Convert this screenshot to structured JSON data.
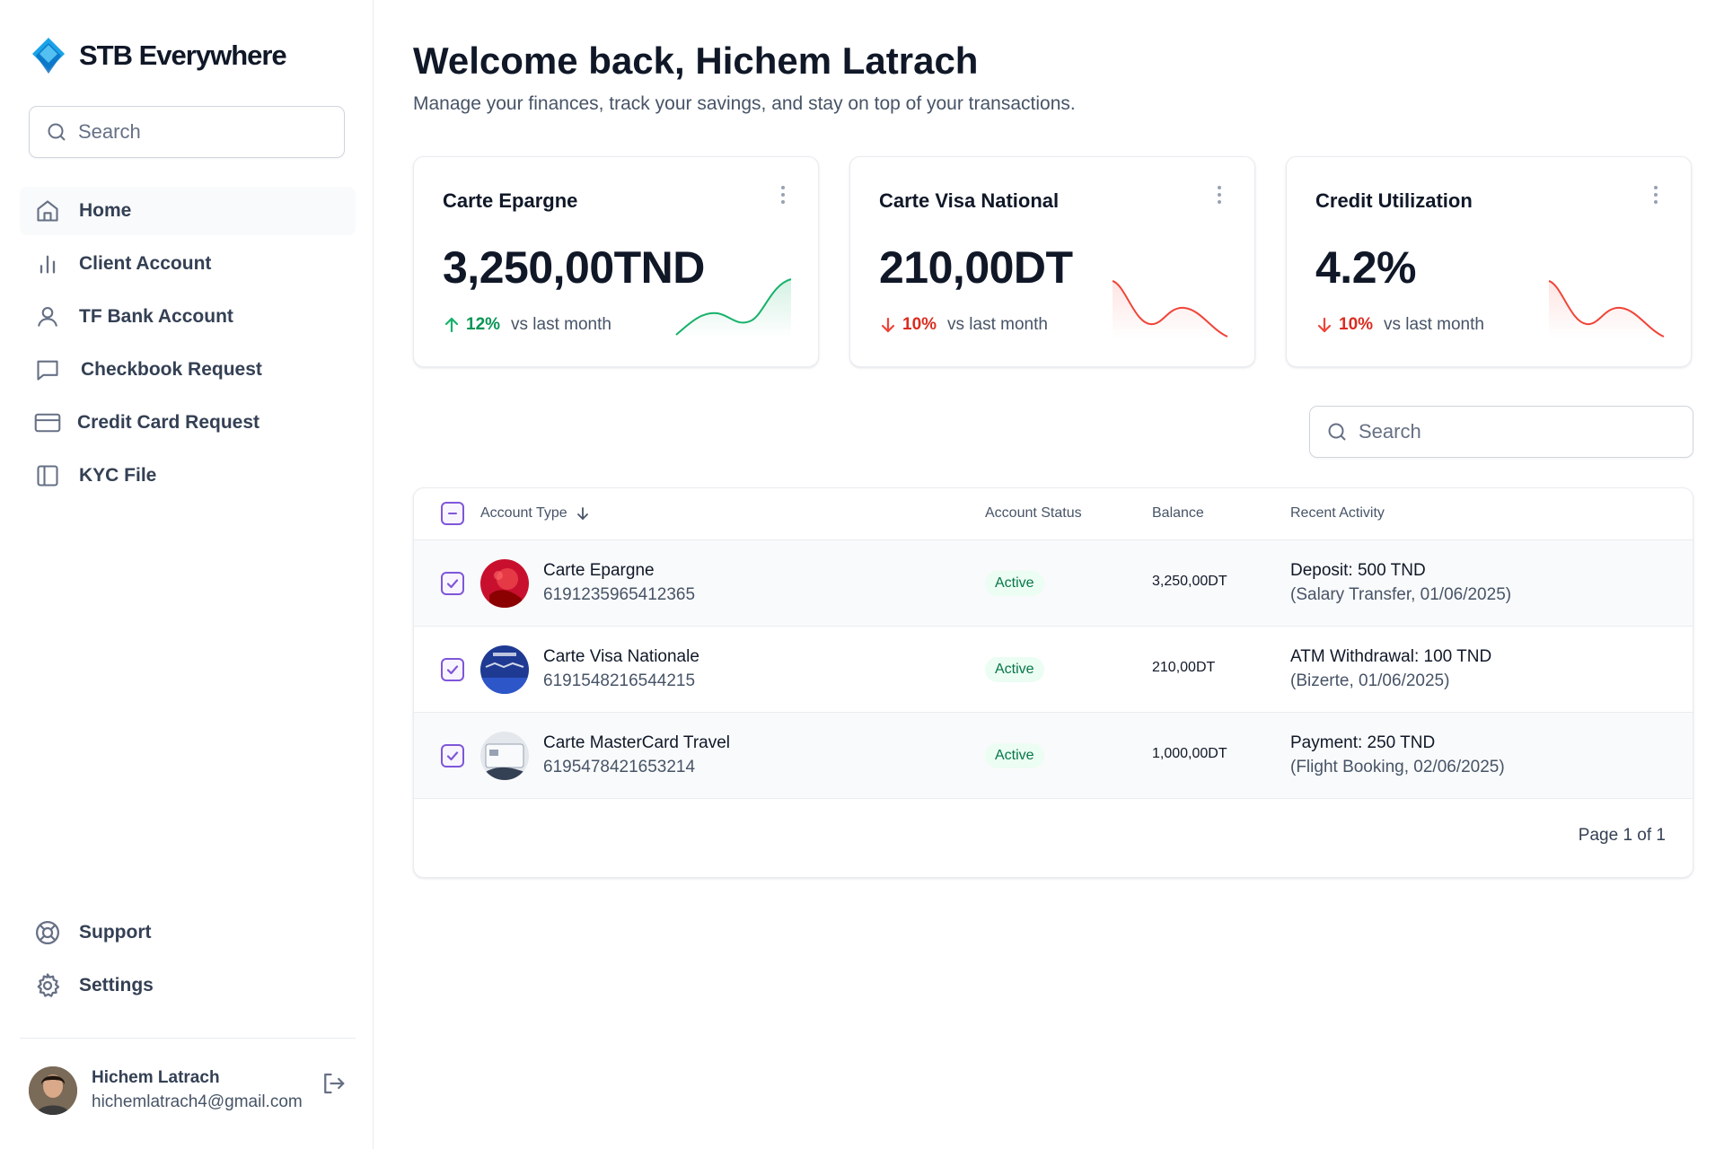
{
  "app": {
    "name": "STB Everywhere"
  },
  "sidebar": {
    "search_placeholder": "Search",
    "items": [
      {
        "label": "Home",
        "icon": "home-icon",
        "active": true
      },
      {
        "label": "Client Account",
        "icon": "bar-chart-icon"
      },
      {
        "label": "TF Bank Account",
        "icon": "user-icon"
      },
      {
        "label": "Checkbook Request",
        "icon": "message-square-icon"
      },
      {
        "label": "Credit Card Request",
        "icon": "credit-card-icon"
      },
      {
        "label": "KYC File",
        "icon": "layout-icon"
      }
    ],
    "bottom_items": [
      {
        "label": "Support",
        "icon": "life-buoy-icon"
      },
      {
        "label": "Settings",
        "icon": "gear-icon"
      }
    ],
    "user": {
      "name": "Hichem Latrach",
      "email": "hichemlatrach4@gmail.com"
    }
  },
  "header": {
    "title": "Welcome back, Hichem Latrach",
    "subtitle": "Manage your finances, track your savings, and stay on top of your transactions."
  },
  "cards": [
    {
      "title": "Carte Epargne",
      "value": "3,250,00TND",
      "trend_dir": "up",
      "trend_pct": "12%",
      "compare": "vs last month",
      "color": "#17b26a"
    },
    {
      "title": "Carte Visa National",
      "value": "210,00DT",
      "trend_dir": "down",
      "trend_pct": "10%",
      "compare": "vs last month",
      "color": "#f04438"
    },
    {
      "title": "Credit Utilization",
      "value": "4.2%",
      "trend_dir": "down",
      "trend_pct": "10%",
      "compare": "vs last month",
      "color": "#f04438"
    }
  ],
  "table": {
    "search_placeholder": "Search",
    "columns": [
      "Account Type",
      "Account Status",
      "Balance",
      "Recent Activity"
    ],
    "rows": [
      {
        "name": "Carte Epargne",
        "number": "6191235965412365",
        "status": "Active",
        "balance": "3,250,00DT",
        "activity": "Deposit: 500 TND",
        "activity_detail": "(Salary Transfer, 01/06/2025)"
      },
      {
        "name": "Carte Visa Nationale",
        "number": "6191548216544215",
        "status": "Active",
        "balance": "210,00DT",
        "activity": "ATM Withdrawal: 100 TND",
        "activity_detail": "(Bizerte, 01/06/2025)"
      },
      {
        "name": "Carte MasterCard Travel",
        "number": "6195478421653214",
        "status": "Active",
        "balance": "1,000,00DT",
        "activity": "Payment: 250 TND",
        "activity_detail": "(Flight Booking, 02/06/2025)"
      }
    ],
    "pagination": "Page 1 of 1"
  }
}
